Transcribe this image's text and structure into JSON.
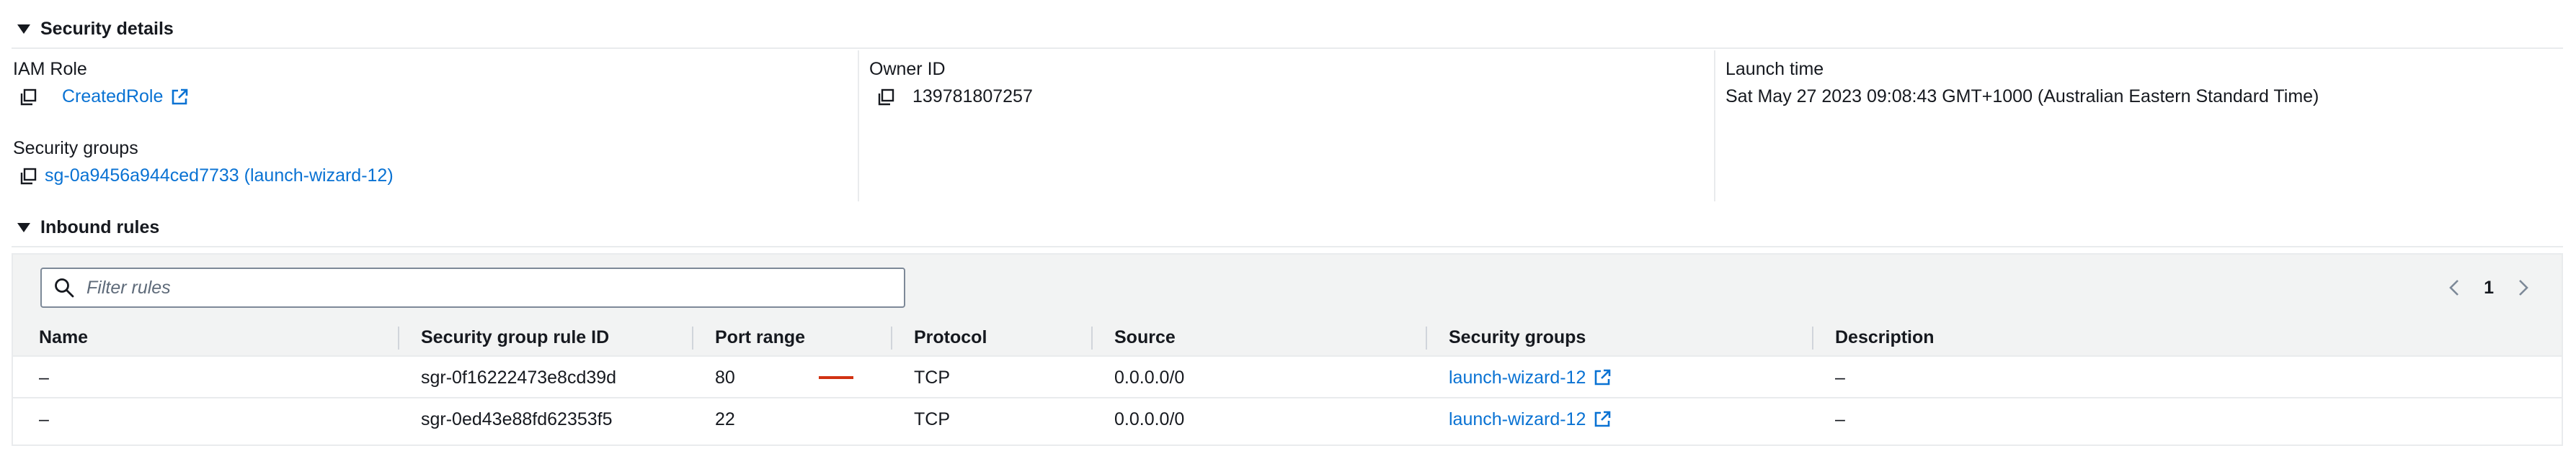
{
  "security_details": {
    "header": "Security details",
    "iam_role": {
      "label": "IAM Role",
      "value": "CreatedRole"
    },
    "owner_id": {
      "label": "Owner ID",
      "value": "139781807257"
    },
    "launch_time": {
      "label": "Launch time",
      "value": "Sat May 27 2023 09:08:43 GMT+1000 (Australian Eastern Standard Time)"
    },
    "security_groups": {
      "label": "Security groups",
      "value": "sg-0a9456a944ced7733 (launch-wizard-12)"
    }
  },
  "inbound_rules": {
    "header": "Inbound rules",
    "filter_placeholder": "Filter rules",
    "page_number": "1",
    "columns": [
      "Name",
      "Security group rule ID",
      "Port range",
      "Protocol",
      "Source",
      "Security groups",
      "Description"
    ],
    "rows": [
      {
        "name": "–",
        "rule_id": "sgr-0f16222473e8cd39d",
        "port_range": "80",
        "protocol": "TCP",
        "source": "0.0.0.0/0",
        "security_group": "launch-wizard-12",
        "description": "–"
      },
      {
        "name": "–",
        "rule_id": "sgr-0ed43e88fd62353f5",
        "port_range": "22",
        "protocol": "TCP",
        "source": "0.0.0.0/0",
        "security_group": "launch-wizard-12",
        "description": "–"
      }
    ]
  },
  "colors": {
    "link": "#0972d3",
    "text": "#16191f",
    "muted": "#5f6b7a",
    "header_bg": "#f2f3f3",
    "annotation_red": "#d13212"
  },
  "icons": [
    "caret-down-icon",
    "copy-icon",
    "external-link-icon",
    "search-icon",
    "chevron-left-icon",
    "chevron-right-icon"
  ]
}
